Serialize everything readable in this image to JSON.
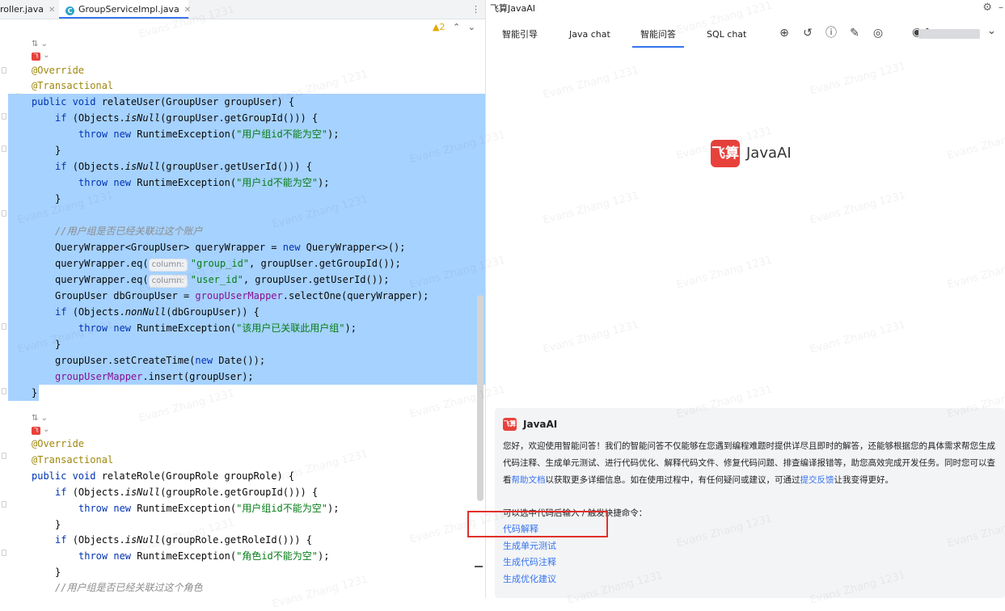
{
  "editor": {
    "tabs": [
      {
        "label": "roller.java",
        "active": false
      },
      {
        "label": "GroupServiceImpl.java",
        "active": true
      }
    ],
    "inspection": {
      "warnings": "2"
    },
    "mini_hint": "⇅",
    "code": {
      "l1_ann": "@Override",
      "l2_ann": "@Transactional",
      "l3_kw1": "public void ",
      "l3_rest": "relateUser(GroupUser groupUser) {",
      "l4_kw": "if ",
      "l4_a": "(Objects.",
      "l4_m": "isNull",
      "l4_b": "(groupUser.getGroupId())) {",
      "l5_kw": "throw new ",
      "l5_a": "RuntimeException(",
      "l5_s": "\"用户组id不能为空\"",
      "l5_b": ");",
      "l6": "}",
      "l7_kw": "if ",
      "l7_a": "(Objects.",
      "l7_m": "isNull",
      "l7_b": "(groupUser.getUserId())) {",
      "l8_kw": "throw new ",
      "l8_a": "RuntimeException(",
      "l8_s": "\"用户id不能为空\"",
      "l8_b": ");",
      "l9": "}",
      "l10_cmt": "//用户组是否已经关联过这个账户",
      "l11_a": "QueryWrapper<GroupUser> queryWrapper = ",
      "l11_kw": "new ",
      "l11_b": "QueryWrapper<>();",
      "l12_a": "queryWrapper.eq(",
      "l12_hint": "column:",
      "l12_s": "\"group_id\"",
      "l12_b": ", groupUser.getGroupId());",
      "l13_a": "queryWrapper.eq(",
      "l13_hint": "column:",
      "l13_s": "\"user_id\"",
      "l13_b": ", groupUser.getUserId());",
      "l14_a": "GroupUser dbGroupUser = ",
      "l14_f": "groupUserMapper",
      "l14_b": ".selectOne(queryWrapper);",
      "l15_kw": "if ",
      "l15_a": "(Objects.",
      "l15_m": "nonNull",
      "l15_b": "(dbGroupUser)) {",
      "l16_kw": "throw new ",
      "l16_a": "RuntimeException(",
      "l16_s": "\"该用户已关联此用户组\"",
      "l16_b": ");",
      "l17": "}",
      "l18_a": "groupUser.setCreateTime(",
      "l18_kw": "new ",
      "l18_b": "Date());",
      "l19_f": "groupUserMapper",
      "l19_b": ".insert(groupUser);",
      "l20": "}",
      "l21_ann": "@Override",
      "l22_ann": "@Transactional",
      "l23_kw": "public void ",
      "l23_rest": "relateRole(GroupRole groupRole) {",
      "l24_kw": "if ",
      "l24_a": "(Objects.",
      "l24_m": "isNull",
      "l24_b": "(groupRole.getGroupId())) {",
      "l25_kw": "throw new ",
      "l25_a": "RuntimeException(",
      "l25_s": "\"用户组id不能为空\"",
      "l25_b": ");",
      "l26": "}",
      "l27_kw": "if ",
      "l27_a": "(Objects.",
      "l27_m": "isNull",
      "l27_b": "(groupRole.getRoleId())) {",
      "l28_kw": "throw new ",
      "l28_a": "RuntimeException(",
      "l28_s": "\"角色id不能为空\"",
      "l28_b": ");",
      "l29": "}",
      "l30_cmt": "//用户组是否已经关联过这个角色"
    }
  },
  "panel": {
    "title": "飞算JavaAI",
    "tabs": [
      "智能引导",
      "Java chat",
      "智能问答",
      "SQL chat"
    ],
    "active_tab": "智能问答",
    "user_number": "1",
    "brand_logo": "飞算",
    "brand_name": "JavaAI",
    "chat": {
      "logo": "飞算",
      "name": "JavaAI",
      "intro": "您好，欢迎使用智能问答！我们的智能问答不仅能够在您遇到编程难题时提供详尽且即时的解答，还能够根据您的具体需求帮您生成代码注释、生成单元测试、进行代码优化、解释代码文件、修复代码问题、排查编译报错等，助您高效完成开发任务。同时您可以查看",
      "help_link": "帮助文档",
      "mid": "以获取更多详细信息。如在使用过程中，有任何疑问或建议，可通过",
      "feedback_link": "提交反馈",
      "end": "让我变得更好。",
      "cmd_hint": "可以选中代码后输入 / 触发快捷命令：",
      "commands": [
        "代码解释",
        "生成单元测试",
        "生成代码注释",
        "生成优化建议"
      ]
    }
  },
  "watermark": "Evans Zhang 1231",
  "colors": {
    "accent": "#3574f0",
    "selection": "#a6d2ff",
    "brand_red": "#e8413c",
    "highlight_box": "#e0312b"
  }
}
